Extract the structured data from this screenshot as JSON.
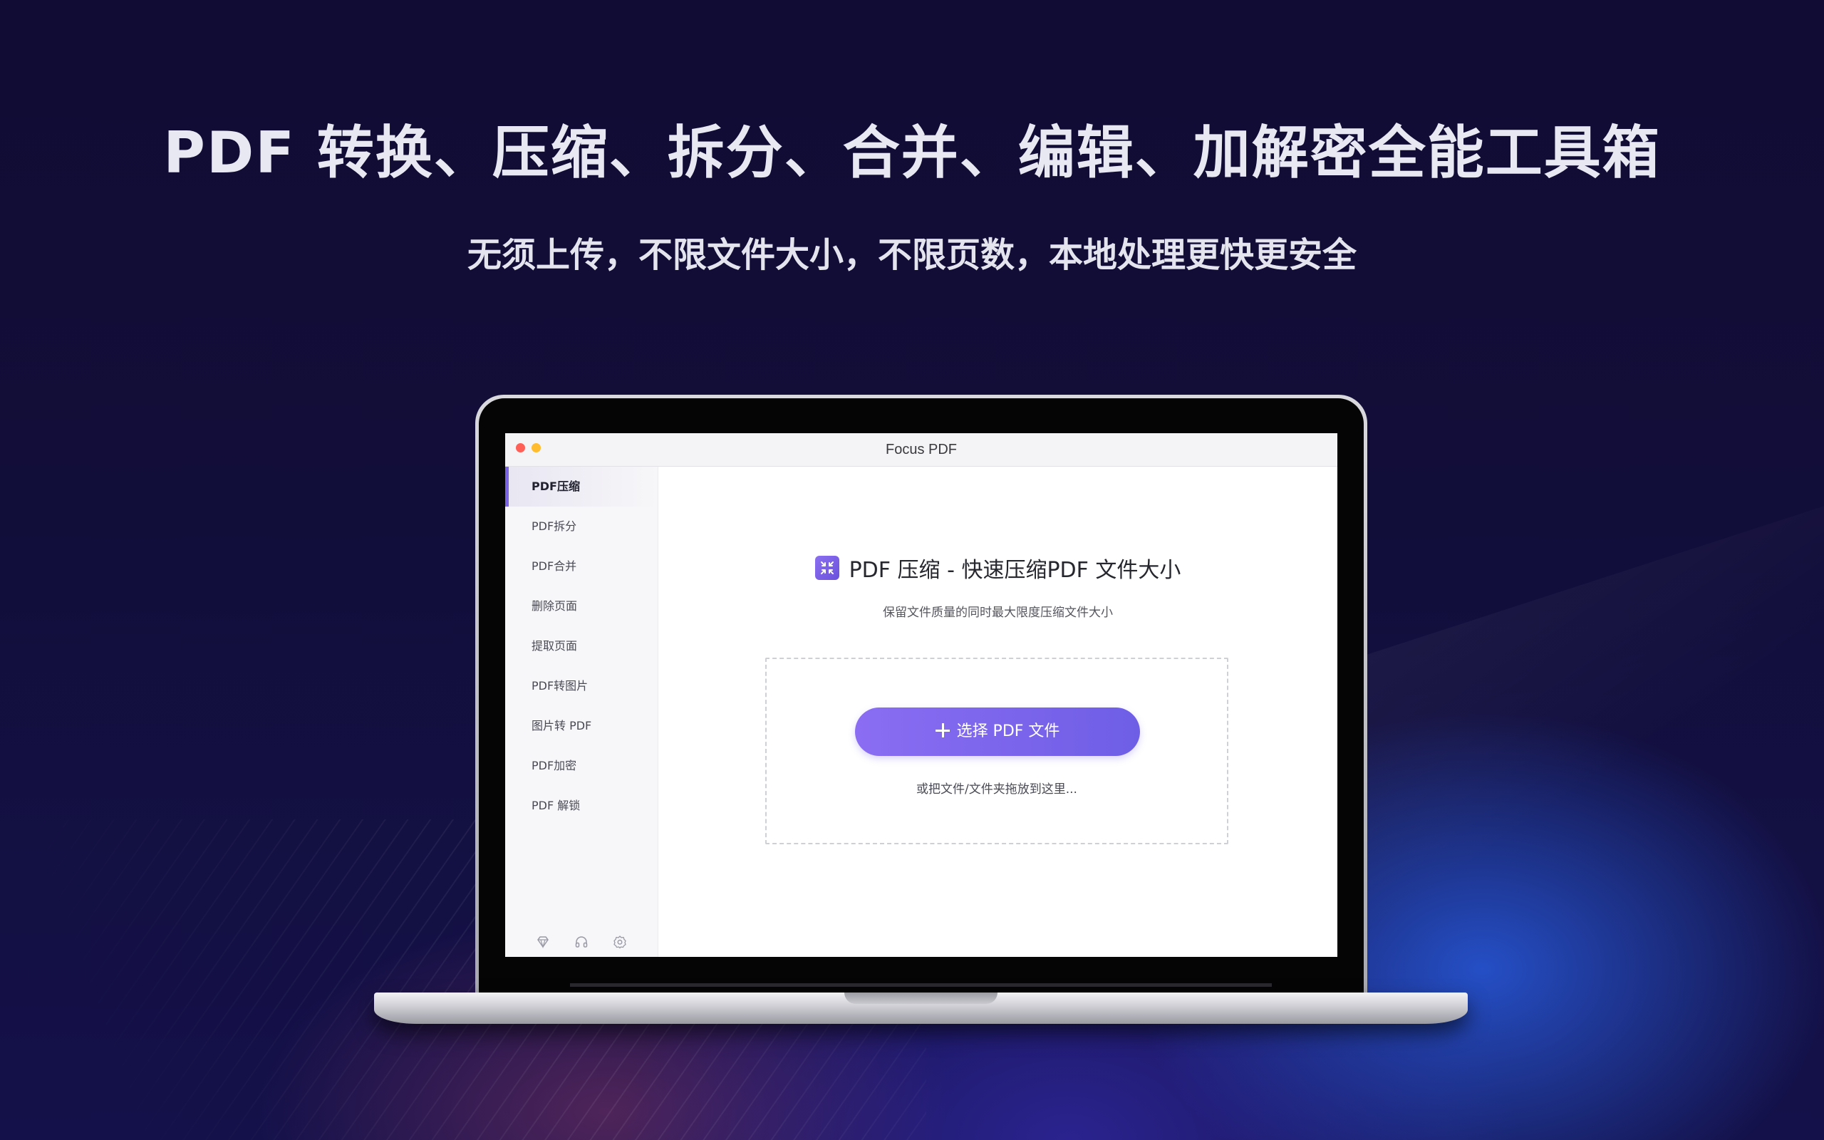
{
  "hero": {
    "title": "PDF 转换、压缩、拆分、合并、编辑、加解密全能工具箱",
    "subtitle": "无须上传，不限文件大小，不限页数，本地处理更快更安全"
  },
  "window": {
    "title": "Focus PDF"
  },
  "sidebar": {
    "items": [
      {
        "label": "PDF压缩",
        "active": true
      },
      {
        "label": "PDF拆分"
      },
      {
        "label": "PDF合并"
      },
      {
        "label": "删除页面"
      },
      {
        "label": "提取页面"
      },
      {
        "label": "PDF转图片"
      },
      {
        "label": "图片转 PDF"
      },
      {
        "label": "PDF加密"
      },
      {
        "label": "PDF 解锁"
      }
    ],
    "footer_icons": [
      "diamond-icon",
      "headphones-icon",
      "gear-icon"
    ]
  },
  "main": {
    "heading_icon": "compress-icon",
    "heading": "PDF 压缩 - 快速压缩PDF 文件大小",
    "description": "保留文件质量的同时最大限度压缩文件大小",
    "select_button": "选择 PDF 文件",
    "drop_hint": "或把文件/文件夹拖放到这里..."
  },
  "colors": {
    "accent": "#7b63e6",
    "background": "#0e0a2e"
  }
}
